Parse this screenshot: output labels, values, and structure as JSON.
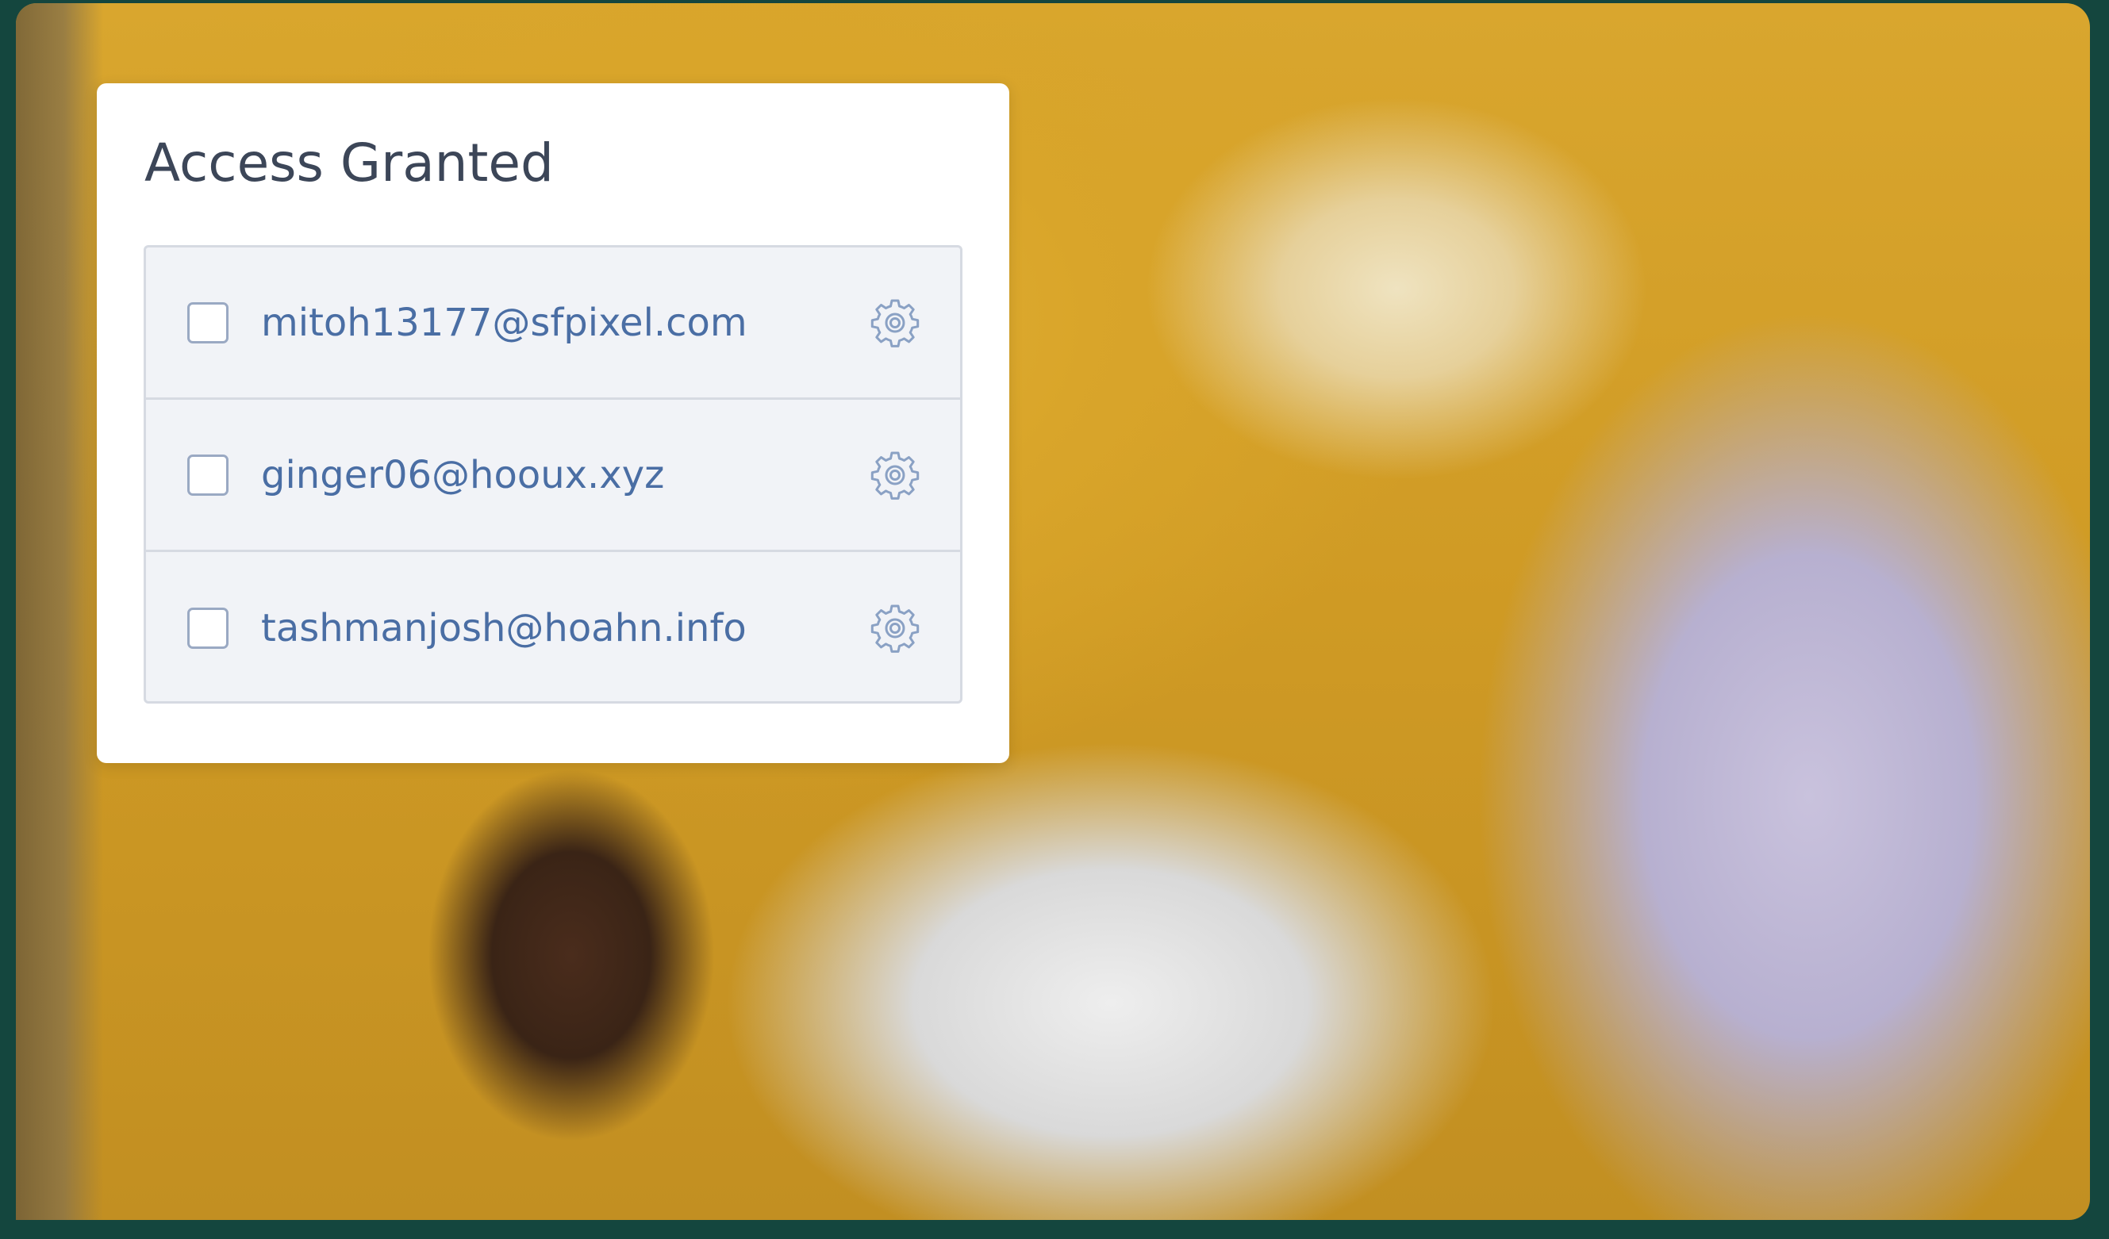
{
  "panel": {
    "title": "Access Granted",
    "items": [
      {
        "email": "mitoh13177@sfpixel.com",
        "checked": false,
        "icon": "gear-icon"
      },
      {
        "email": "ginger06@hooux.xyz",
        "checked": false,
        "icon": "gear-icon"
      },
      {
        "email": "tashmanjosh@hoahn.info",
        "checked": false,
        "icon": "gear-icon"
      }
    ]
  },
  "colors": {
    "frame": "#14463e",
    "title": "#3c4658",
    "email": "#4a6ea4",
    "list_bg": "#f1f3f7",
    "border": "#d6dae2",
    "icon": "#8aa1c4"
  }
}
